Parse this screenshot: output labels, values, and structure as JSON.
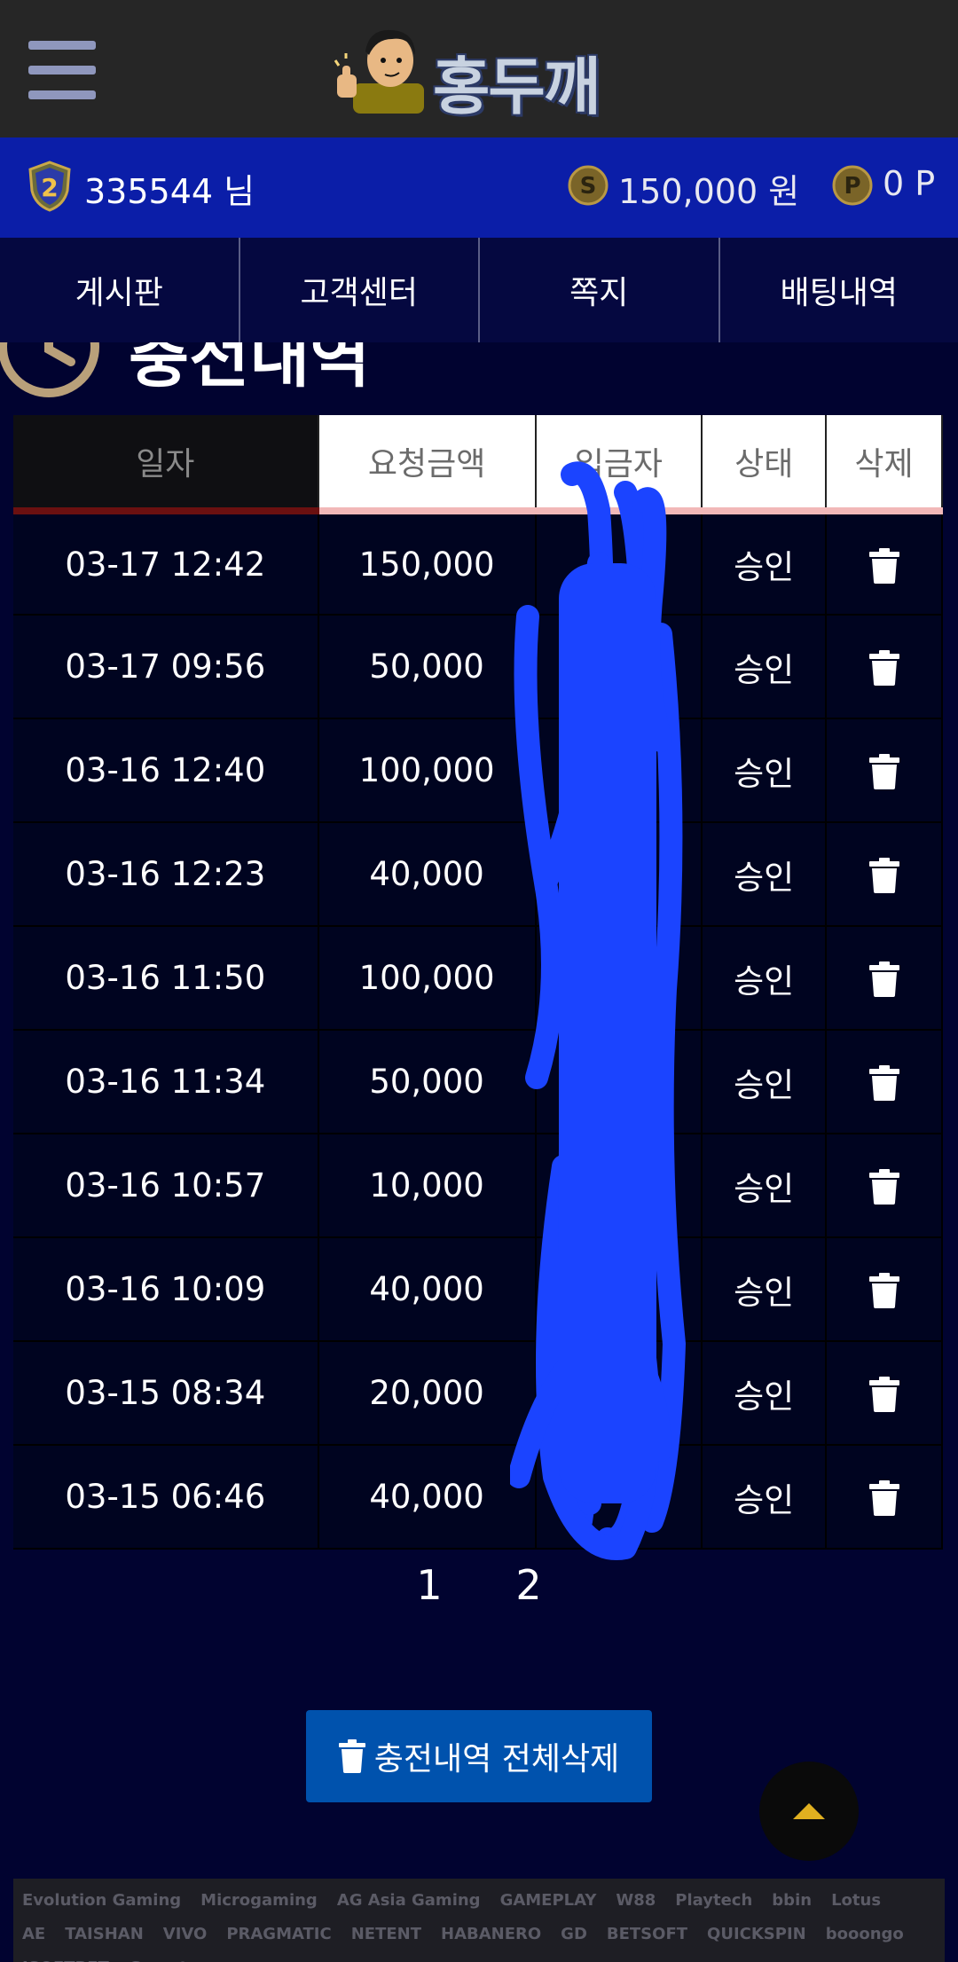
{
  "header": {
    "logo_text": "홍두깨",
    "menu_icon": "hamburger-menu-icon"
  },
  "user": {
    "level": "2",
    "name": "335544 님",
    "money": "150,000 원",
    "money_icon": "S",
    "point": "0 P",
    "point_icon": "P"
  },
  "nav": {
    "tabs": [
      "게시판",
      "고객센터",
      "쪽지",
      "배팅내역"
    ]
  },
  "section": {
    "title": "충전내역"
  },
  "table": {
    "headers": [
      "일자",
      "요청금액",
      "입금자",
      "상태",
      "삭제"
    ],
    "rows": [
      {
        "date": "03-17 12:42",
        "amount": "150,000",
        "status": "승인"
      },
      {
        "date": "03-17 09:56",
        "amount": "50,000",
        "status": "승인"
      },
      {
        "date": "03-16 12:40",
        "amount": "100,000",
        "status": "승인"
      },
      {
        "date": "03-16 12:23",
        "amount": "40,000",
        "status": "승인"
      },
      {
        "date": "03-16 11:50",
        "amount": "100,000",
        "status": "승인"
      },
      {
        "date": "03-16 11:34",
        "amount": "50,000",
        "status": "승인"
      },
      {
        "date": "03-16 10:57",
        "amount": "10,000",
        "status": "승인"
      },
      {
        "date": "03-16 10:09",
        "amount": "40,000",
        "status": "승인"
      },
      {
        "date": "03-15 08:34",
        "amount": "20,000",
        "status": "승인"
      },
      {
        "date": "03-15 06:46",
        "amount": "40,000",
        "status": "승인"
      }
    ]
  },
  "pagination": {
    "pages": [
      "1",
      "2"
    ],
    "current": "1"
  },
  "actions": {
    "delete_all_label": "충전내역 전체삭제"
  },
  "providers": [
    "Evolution Gaming",
    "Microgaming",
    "AG Asia Gaming",
    "GAMEPLAY",
    "W88",
    "Playtech",
    "bbin",
    "Lotus",
    "AE",
    "TAISHAN",
    "VIVO",
    "PRAGMATIC",
    "NETENT",
    "HABANERO",
    "GD",
    "BETSOFT",
    "QUICKSPIN",
    "booongo",
    "ISOFTBET",
    "Gamatron"
  ],
  "colors": {
    "header_bg": "#262626",
    "userbar_bg": "#0b1ea8",
    "nav_bg": "#050840",
    "page_bg": "#010330",
    "button_blue": "#0052ad",
    "scribble_blue": "#1b44ff"
  }
}
